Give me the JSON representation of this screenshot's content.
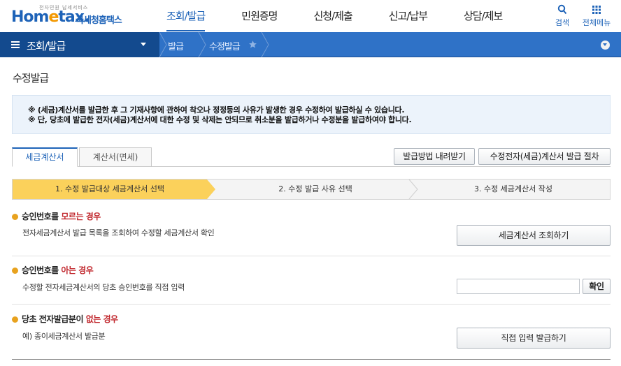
{
  "header": {
    "logo_small": "전자민원 납세서비스",
    "logo_main_a": "Hom",
    "logo_main_b": "e",
    "logo_main_c": "tax.",
    "logo_ko": "국세청홈택스",
    "menu": [
      "조회/발급",
      "민원증명",
      "신청/제출",
      "신고/납부",
      "상담/제보"
    ],
    "search_label": "검색",
    "allmenu_label": "전체메뉴"
  },
  "nav": {
    "section": "조회/발급",
    "crumbs": [
      "발급",
      "수정발급"
    ]
  },
  "page": {
    "title": "수정발급",
    "notice": [
      "※ (세금)계산서를 발급한 후 그 기재사항에 관하여 착오나 정정등의 사유가 발생한 경우 수정하여 발급하실 수 있습니다.",
      "※ 단, 당초에 발급한 전자(세금)계산서에 대한 수정 및 삭제는 안되므로 취소분을 발급하거나 수정분을 발급하여야 합니다."
    ]
  },
  "tabs": [
    "세금계산서",
    "계산서(면세)"
  ],
  "buttons": {
    "download": "발급방법 내려받기",
    "procedure": "수정전자(세금)계산서 발급 절차",
    "lookup": "세금계산서 조회하기",
    "confirm": "확인",
    "direct": "직접 입력 발급하기"
  },
  "steps": [
    "1. 수정 발급대상 세금계산서 선택",
    "2. 수정 발급 사유 선택",
    "3. 수정 세금계산서 작성"
  ],
  "sections": [
    {
      "title_a": "승인번호를 ",
      "title_em": "모르는 경우",
      "title_b": "",
      "desc": "전자세금계산서 발급 목록을 조회하여 수정할 세금계산서 확인"
    },
    {
      "title_a": "승인번호를 ",
      "title_em": "아는 경우",
      "title_b": "",
      "desc": "수정할 전자세금계산서의 당초 승인번호를 직접 입력"
    },
    {
      "title_a": "당초 전자발급분이 ",
      "title_em": "없는 경우",
      "title_b": "",
      "desc": "예) 종이세금계산서 발급분"
    }
  ],
  "colors": {
    "brand": "#1e63b8",
    "nav": "#2f72c7",
    "nav_dark": "#134a8e",
    "step_active": "#fbd15b",
    "emphasis": "#c1272d"
  }
}
